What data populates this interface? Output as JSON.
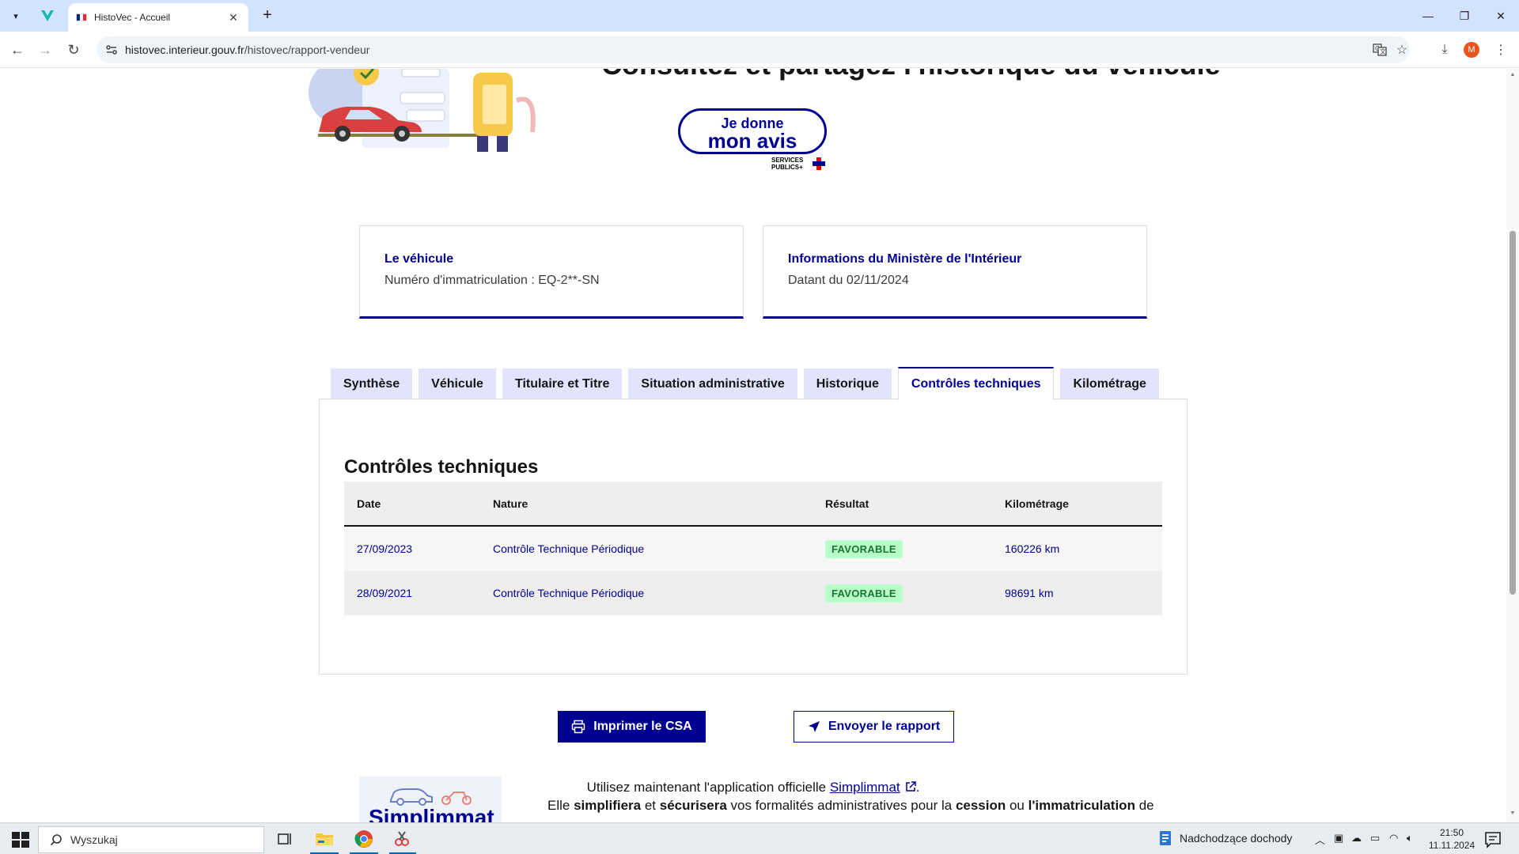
{
  "browser": {
    "tab_title": "HistoVec - Accueil",
    "url_host": "histovec.interieur.gouv.fr",
    "url_path": "/histovec/rapport-vendeur",
    "profile_initial": "M"
  },
  "page": {
    "hero_title": "Consultez et partagez l'historique du véhicule",
    "avis_line1": "Je donne",
    "avis_line2": "mon avis",
    "avis_sp1": "SERVICES",
    "avis_sp2": "PUBLICS+",
    "cards": [
      {
        "title": "Le véhicule",
        "text": "Numéro d'immatriculation : EQ-2**-SN"
      },
      {
        "title": "Informations du Ministère de l'Intérieur",
        "text": "Datant du 02/11/2024"
      }
    ],
    "tabs": [
      {
        "label": "Synthèse"
      },
      {
        "label": "Véhicule"
      },
      {
        "label": "Titulaire et Titre"
      },
      {
        "label": "Situation administrative"
      },
      {
        "label": "Historique"
      },
      {
        "label": "Contrôles techniques"
      },
      {
        "label": "Kilométrage"
      }
    ],
    "active_tab": "Contrôles techniques",
    "section_title": "Contrôles techniques",
    "table": {
      "headers": [
        "Date",
        "Nature",
        "Résultat",
        "Kilométrage"
      ],
      "rows": [
        {
          "date": "27/09/2023",
          "nature": "Contrôle Technique Périodique",
          "result": "FAVORABLE",
          "km": "160226 km"
        },
        {
          "date": "28/09/2021",
          "nature": "Contrôle Technique Périodique",
          "result": "FAVORABLE",
          "km": "98691 km"
        }
      ]
    },
    "print_button": "Imprimer le CSA",
    "send_button": "Envoyer le rapport",
    "simplimmat": {
      "logo_text": "Simplimmat",
      "line1_pre": "Utilisez maintenant l'application officielle ",
      "line1_link": "Simplimmat",
      "line1_post": ".",
      "l2_a": "Elle ",
      "l2_b": "simplifiera",
      "l2_c": " et ",
      "l2_d": "sécurisera",
      "l2_e": " vos formalités administratives pour la ",
      "l2_f": "cession",
      "l2_g": " ou ",
      "l2_h": "l'immatriculation",
      "l2_i": " de"
    }
  },
  "taskbar": {
    "search_text": "Wyszukaj",
    "news_text": "Nadchodzące dochody",
    "time": "21:50",
    "date": "11.11.2024"
  },
  "colors": {
    "brand_blue": "#000091",
    "tab_inactive": "#e3e3fd",
    "success_bg": "#b8fec9",
    "success_text": "#18753c"
  }
}
